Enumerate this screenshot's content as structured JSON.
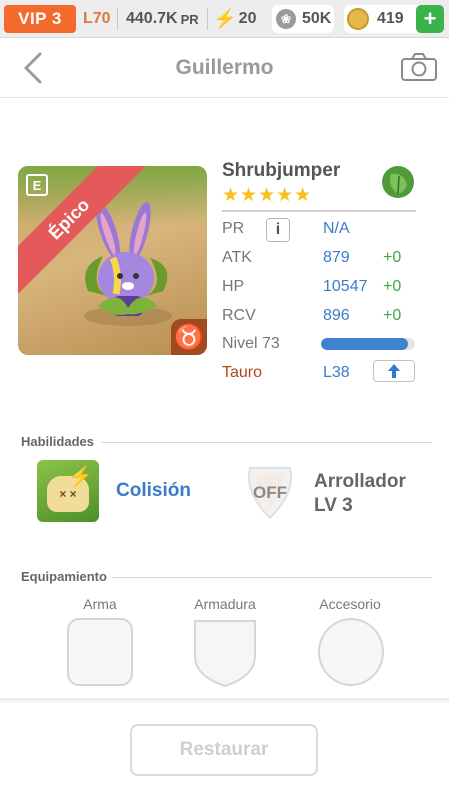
{
  "statusbar": {
    "vip": "VIP 3",
    "level": "L70",
    "power_value": "440.7K",
    "power_unit": "PR",
    "energy": "20",
    "paws": "50K",
    "gold": "419"
  },
  "header": {
    "title": "Guillermo"
  },
  "monster": {
    "rarity": "Épico",
    "name": "Shrubjumper",
    "stars": "★★★★★",
    "star_count": 5,
    "element_icon": "leaf-icon",
    "zodiac_glyph": "♉",
    "stats": {
      "pr_label": "PR",
      "pr_value": "N/A",
      "atk_label": "ATK",
      "atk_value": "879",
      "atk_bonus": "+0",
      "hp_label": "HP",
      "hp_value": "10547",
      "hp_bonus": "+0",
      "rcv_label": "RCV",
      "rcv_value": "896",
      "rcv_bonus": "+0",
      "level_label": "Nivel 73",
      "level_progress": 0.93,
      "sign_label": "Tauro",
      "sign_level": "L38"
    }
  },
  "skills": {
    "section_title": "Habilidades",
    "active_name": "Colisión",
    "passive_state": "OFF",
    "passive_name_line1": "Arrollador",
    "passive_name_line2": "LV 3"
  },
  "equipment": {
    "section_title": "Equipamiento",
    "slots": [
      "Arma",
      "Armadura",
      "Accesorio"
    ]
  },
  "footer": {
    "restore_label": "Restaurar"
  },
  "colors": {
    "vip_orange": "#f26a2c",
    "stat_blue": "#3b7cc9",
    "bonus_green": "#3ea84a",
    "rarity_red": "#e45a5a",
    "zodiac_brown": "#a04a22"
  }
}
